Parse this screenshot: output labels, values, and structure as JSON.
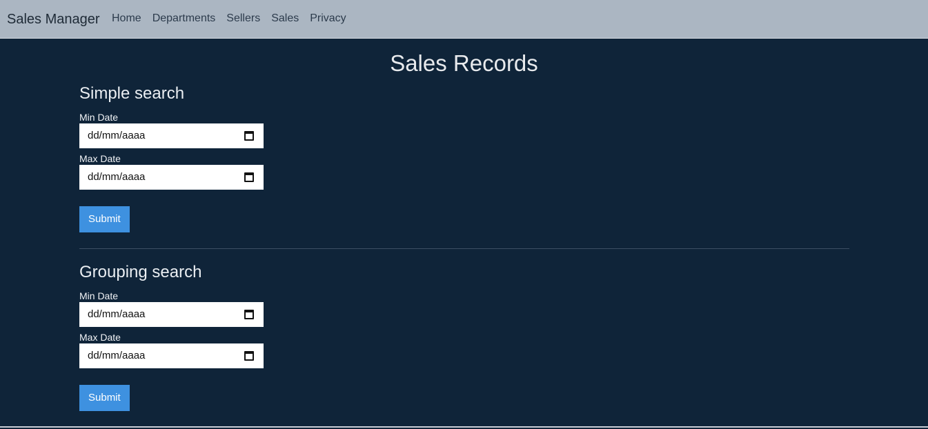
{
  "navbar": {
    "brand": "Sales Manager",
    "links": [
      "Home",
      "Departments",
      "Sellers",
      "Sales",
      "Privacy"
    ]
  },
  "page": {
    "title": "Sales Records"
  },
  "simple_search": {
    "title": "Simple search",
    "min_label": "Min Date",
    "min_value": "dd/mm/aaaa",
    "max_label": "Max Date",
    "max_value": "dd/mm/aaaa",
    "submit_label": "Submit"
  },
  "grouping_search": {
    "title": "Grouping search",
    "min_label": "Min Date",
    "min_value": "dd/mm/aaaa",
    "max_label": "Max Date",
    "max_value": "dd/mm/aaaa",
    "submit_label": "Submit"
  },
  "colors": {
    "navbar_bg": "#abb6c2",
    "page_bg": "#0f2439",
    "button_bg": "#3e91e0"
  },
  "icons": {
    "date_picker": "calendar-icon"
  }
}
